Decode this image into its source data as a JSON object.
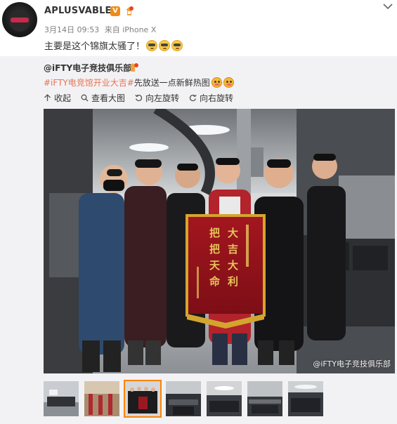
{
  "post": {
    "username": "APLUSVABLE",
    "verified_badge": "V",
    "meta_time": "3月14日 09:53",
    "meta_source": "来自 iPhone X",
    "text": "主要是这个锦旗太骚了！",
    "emoji_name": "doge-emoji",
    "emoji_count": 3
  },
  "repost": {
    "user": "@iFTY电子竞技俱乐部",
    "hashtag": "#iFTY电竞馆开业大吉#",
    "text": "先放送一点新鲜热图",
    "emoji_name": "blush-emoji",
    "emoji_count": 2
  },
  "toolbar": {
    "items": [
      {
        "label": "收起",
        "icon": "arrow-up-icon"
      },
      {
        "label": "查看大图",
        "icon": "search-icon"
      },
      {
        "label": "向左旋转",
        "icon": "rotate-left-icon"
      },
      {
        "label": "向右旋转",
        "icon": "rotate-right-icon"
      }
    ]
  },
  "photo": {
    "banner_chars": "大吉大利 把把天命",
    "watermark": "@iFTY电子竞技俱乐部"
  },
  "thumbnails": {
    "count": 7,
    "active_index": 2
  },
  "colors": {
    "hashtag": "#eb7350",
    "badge": "#ef8b14",
    "active_thumb": "#ff8200",
    "repost_bg": "#f2f2f5"
  }
}
